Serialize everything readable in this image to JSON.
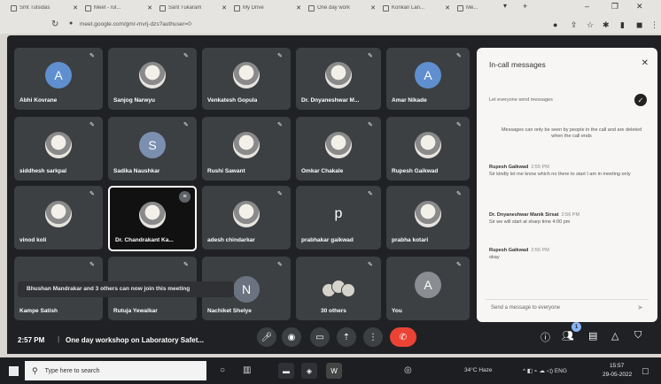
{
  "browser": {
    "tabs": [
      {
        "label": "Smt Tulsidas"
      },
      {
        "label": "Meet - rul..."
      },
      {
        "label": "Sant Tukaram"
      },
      {
        "label": "My Drive"
      },
      {
        "label": "One day work"
      },
      {
        "label": "Konkan Lan..."
      },
      {
        "label": "Me..."
      }
    ],
    "url": "meet.google.com/gmr-mvrj-dzs?authuser=0"
  },
  "participants": [
    {
      "name": "Abhi Kovrane",
      "initial": "A",
      "color": "#5f8fcf"
    },
    {
      "name": "Sanjog Narwyu",
      "initial": "",
      "color": ""
    },
    {
      "name": "Venkatesh Gopula",
      "initial": "",
      "color": ""
    },
    {
      "name": "Dr. Dnyaneshwar M...",
      "initial": "",
      "color": ""
    },
    {
      "name": "Amar Nikade",
      "initial": "A",
      "color": "#5f8fcf"
    },
    {
      "name": "siddhesh sarkpal",
      "initial": "",
      "color": ""
    },
    {
      "name": "Sadika Naushkar",
      "initial": "S",
      "color": "#7b8fb0"
    },
    {
      "name": "Rushi Sawant",
      "initial": "",
      "color": ""
    },
    {
      "name": "Omkar Chakale",
      "initial": "",
      "color": ""
    },
    {
      "name": "Rupesh Gaikwad",
      "initial": "",
      "color": ""
    },
    {
      "name": "vinod koli",
      "initial": "",
      "color": ""
    },
    {
      "name": "Dr. Chandrakant Ka...",
      "initial": "",
      "color": ""
    },
    {
      "name": "adesh chindarkar",
      "initial": "",
      "color": ""
    },
    {
      "name": "prabhakar gaikwad",
      "initial": "p",
      "color": ""
    },
    {
      "name": "prabha kotari",
      "initial": "",
      "color": ""
    },
    {
      "name": "Kampe Satish",
      "initial": "",
      "color": ""
    },
    {
      "name": "Rutuja Yewalkar",
      "initial": "",
      "color": ""
    },
    {
      "name": "Nachiket Shelye",
      "initial": "N",
      "color": "#6b7280"
    },
    {
      "name": "30 others",
      "initial": "",
      "color": ""
    },
    {
      "name": "You",
      "initial": "A",
      "color": "#8a8d91"
    }
  ],
  "toast": "Bhushan Mandrakar and 3 others can now join this meeting",
  "bottom_bar": {
    "time": "2:57 PM",
    "divider": "|",
    "meeting_title": "One day workshop on Laboratory Safet..."
  },
  "chat": {
    "title": "In-call messages",
    "toggle_label": "Let everyone send messages",
    "notice": "Messages can only be seen by people in the call and are deleted when the call ends",
    "messages": [
      {
        "sender": "Rupesh Gaikwad",
        "time": "2:55 PM",
        "text": "Sir kindly let me know which no there to start I am in meeting only"
      },
      {
        "sender": "Dr. Dnyaneshwar Manik Sirsat",
        "time": "2:56 PM",
        "text": "Sir we will start at sharp time 4:00 pm"
      },
      {
        "sender": "Rupesh Gaikwad",
        "time": "2:56 PM",
        "text": "okay"
      }
    ],
    "input_placeholder": "Send a message to everyone",
    "badge_count": "1"
  },
  "taskbar": {
    "search_placeholder": "Type here to search",
    "weather": "34°C Haze",
    "lang": "ENG",
    "clock_time": "15:57",
    "clock_date": "29-05-2022"
  },
  "colors": {
    "meet_bg": "#202124",
    "tile_bg": "#3c4043",
    "end_call": "#ea4335",
    "accent": "#8ab4f8"
  }
}
